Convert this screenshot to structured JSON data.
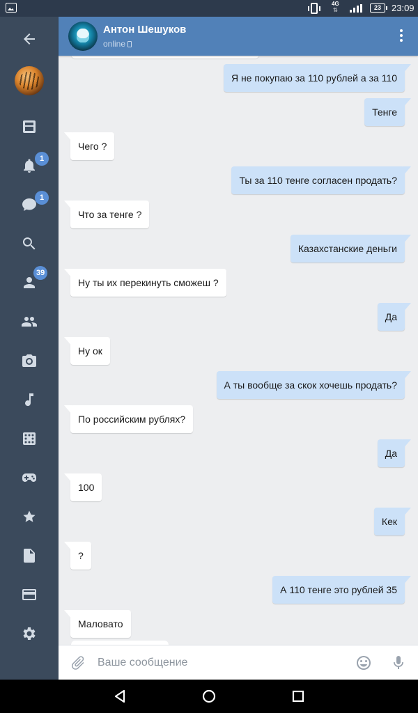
{
  "status_bar": {
    "network": "4G",
    "battery": "23",
    "time": "23:09"
  },
  "sidebar": {
    "items": [
      {
        "icon": "back-arrow-icon"
      },
      {
        "icon": "profile-avatar"
      },
      {
        "icon": "news-icon"
      },
      {
        "icon": "bell-icon",
        "badge": "1"
      },
      {
        "icon": "messages-icon",
        "badge": "1"
      },
      {
        "icon": "search-icon"
      },
      {
        "icon": "friends-icon",
        "badge": "39"
      },
      {
        "icon": "groups-icon"
      },
      {
        "icon": "camera-icon"
      },
      {
        "icon": "music-icon"
      },
      {
        "icon": "games-icon"
      },
      {
        "icon": "gamepad-icon"
      },
      {
        "icon": "star-icon"
      },
      {
        "icon": "document-icon"
      },
      {
        "icon": "payment-card-icon"
      },
      {
        "icon": "settings-icon"
      }
    ]
  },
  "header": {
    "name": "Антон Шешуков",
    "status": "online"
  },
  "messages": [
    {
      "dir": "out",
      "text": "Я не покупаю за 110 рублей а за  110"
    },
    {
      "dir": "out",
      "text": "Тенге"
    },
    {
      "dir": "in",
      "text": "Чего ?"
    },
    {
      "dir": "out",
      "text": "Ты за 110 тенге согласен продать?"
    },
    {
      "dir": "in",
      "text": "Что за тенге ?"
    },
    {
      "dir": "out",
      "text": "Казахстанские деньги"
    },
    {
      "dir": "in",
      "text": "Ну ты их перекинуть сможеш ?"
    },
    {
      "dir": "out",
      "text": "Да"
    },
    {
      "dir": "in",
      "text": "Ну ок"
    },
    {
      "dir": "out",
      "text": "А ты вообще за скок хочешь продать?"
    },
    {
      "dir": "in",
      "text": "По российским рублях?"
    },
    {
      "dir": "out",
      "text": "Да"
    },
    {
      "dir": "in",
      "text": "100"
    },
    {
      "dir": "out",
      "text": "Кек"
    },
    {
      "dir": "in",
      "text": "?"
    },
    {
      "dir": "out",
      "text": "А 110 тенге это рублей 35"
    },
    {
      "dir": "in",
      "text": "Маловато"
    }
  ],
  "composer": {
    "placeholder": "Ваше сообщение"
  },
  "colors": {
    "header": "#5181b8",
    "sidebar": "#3b4a5c",
    "chat_background": "#edeef0",
    "outgoing_bubble": "#cce1f8",
    "incoming_bubble": "#ffffff",
    "badge": "#5a8fd6"
  }
}
